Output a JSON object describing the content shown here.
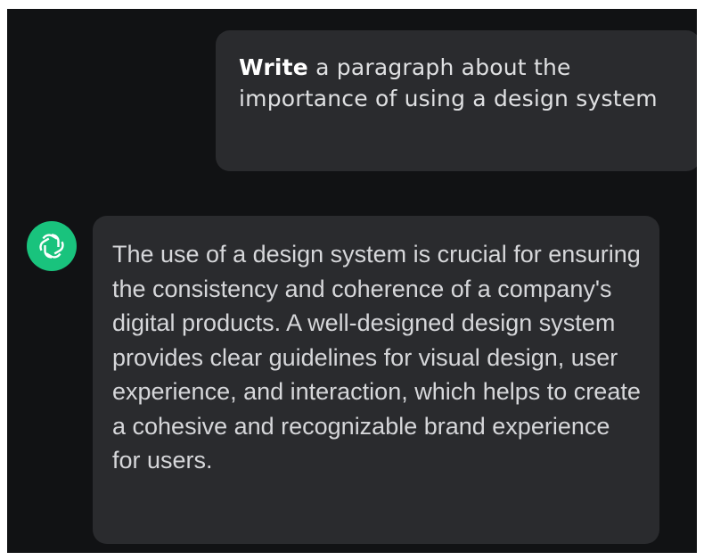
{
  "conversation": {
    "user_message": {
      "bold_prefix": "Write",
      "text": " a paragraph about the importance of using a design system"
    },
    "assistant_message": {
      "avatar_icon": "openai-logo-icon",
      "avatar_color": "#19c37d",
      "text": "The use of a design system is crucial for ensuring the consistency and coherence of a company's digital products. A well-designed design system provides clear guidelines for visual design, user experience, and interaction, which helps to create a cohesive and recognizable brand experience for users."
    }
  },
  "colors": {
    "background": "#111214",
    "bubble": "#2a2b2e",
    "text": "#d6d7da"
  }
}
